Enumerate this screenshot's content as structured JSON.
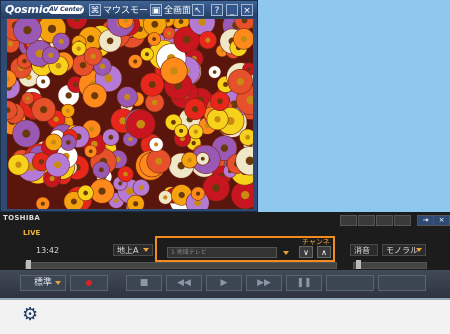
{
  "window": {
    "logo": "Qosmio",
    "logo_sub": "AV Center",
    "mouse_mode_label": "マウスモード",
    "fullscreen_label": "全画面",
    "buttons": {
      "help": "?",
      "minimize": "_",
      "close": "×"
    }
  },
  "player": {
    "brand": "TOSHIBA",
    "live": "LIVE",
    "time": "13:42",
    "source_select": "地上A",
    "channel_label": "チャンネル",
    "channel_value": "1 地域テレビ",
    "channel_down": "∨",
    "channel_up": "∧",
    "audio_effect": "消音",
    "audio_mode": "モノラル",
    "quality": "標準"
  },
  "colors": {
    "highlight": "#f28c1e",
    "accent": "#e8a33a"
  }
}
